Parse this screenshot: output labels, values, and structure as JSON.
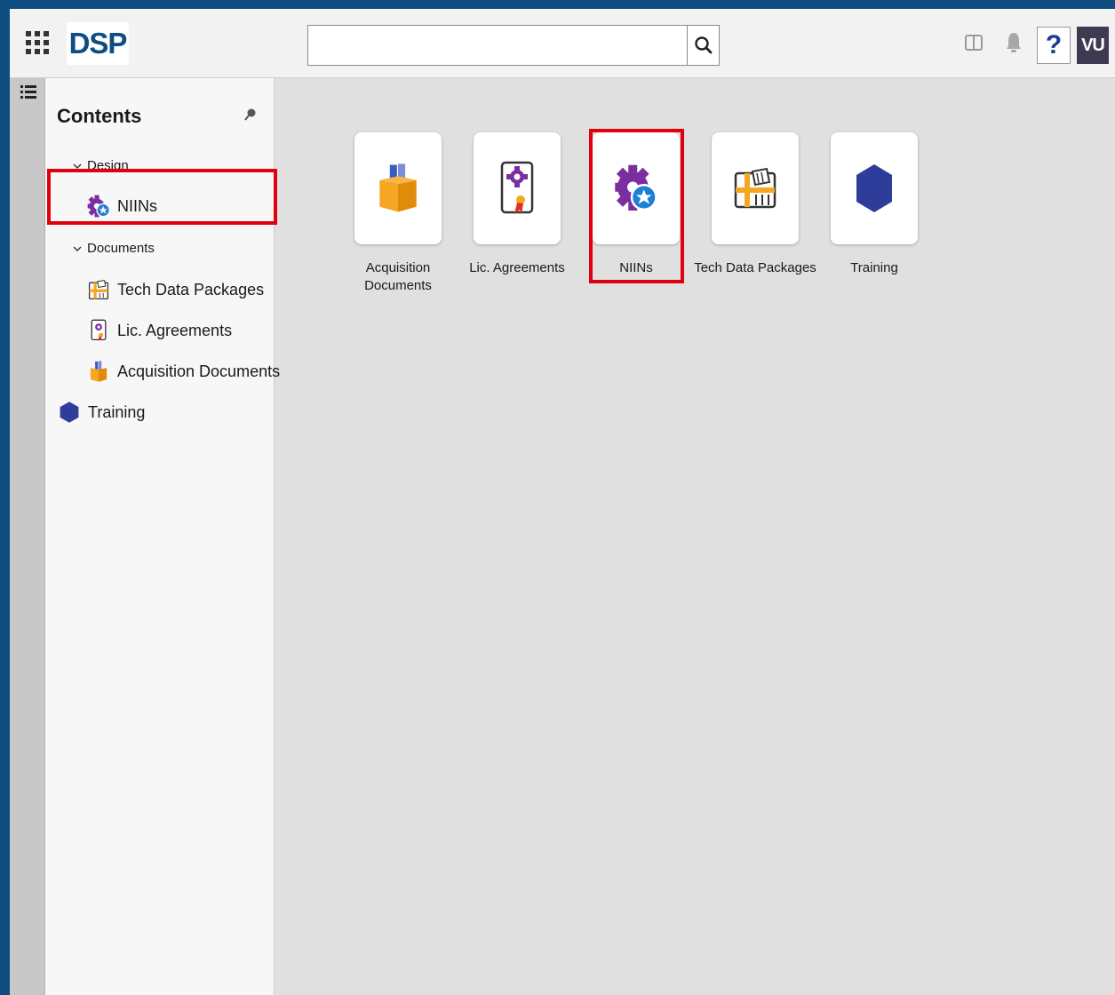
{
  "header": {
    "logo_text": "DSP",
    "search": {
      "value": "",
      "placeholder": ""
    },
    "help_label": "?",
    "avatar_initials": "VU"
  },
  "sidebar": {
    "title": "Contents",
    "groups": [
      {
        "label": "Design",
        "items": [
          {
            "label": "NIINs",
            "icon": "niins-gear-icon"
          }
        ]
      },
      {
        "label": "Documents",
        "items": [
          {
            "label": "Tech Data Packages",
            "icon": "tech-data-icon"
          },
          {
            "label": "Lic. Agreements",
            "icon": "license-icon"
          },
          {
            "label": "Acquisition Documents",
            "icon": "acquisition-box-icon"
          }
        ]
      }
    ],
    "root_items": [
      {
        "label": "Training",
        "icon": "hexagon-icon"
      }
    ]
  },
  "tiles": [
    {
      "label": "Acquisition Documents",
      "icon": "acquisition-box-icon"
    },
    {
      "label": "Lic. Agreements",
      "icon": "license-icon"
    },
    {
      "label": "NIINs",
      "icon": "niins-gear-icon"
    },
    {
      "label": "Tech Data Packages",
      "icon": "tech-data-icon"
    },
    {
      "label": "Training",
      "icon": "hexagon-icon"
    }
  ],
  "colors": {
    "frame_border": "#0f4c81",
    "highlight": "#e0000f",
    "training_hexagon": "#2e3c9a",
    "niins_purple": "#7b2ea0",
    "niins_badge": "#1f7fd6",
    "acquisition_orange": "#f5a623",
    "avatar_bg": "#3e3a52"
  }
}
